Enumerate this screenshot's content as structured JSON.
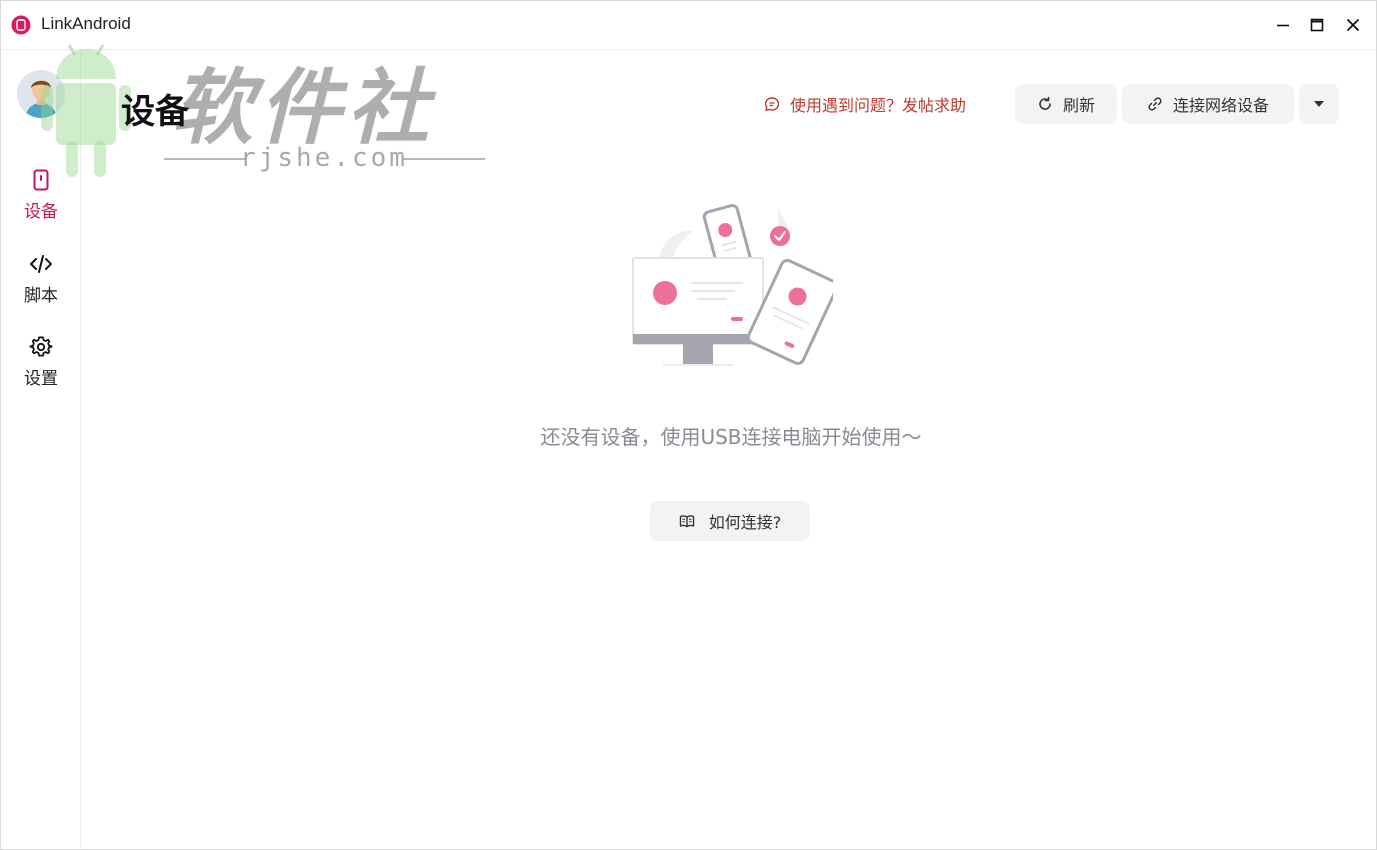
{
  "window": {
    "title": "LinkAndroid"
  },
  "sidebar": {
    "items": [
      {
        "id": "devices",
        "label": "设备",
        "icon": "phone-icon",
        "active": true
      },
      {
        "id": "scripts",
        "label": "脚本",
        "icon": "code-icon",
        "active": false
      },
      {
        "id": "settings",
        "label": "设置",
        "icon": "gear-icon",
        "active": false
      }
    ]
  },
  "watermark": {
    "title": "软件社",
    "subtitle": "rjshe.com"
  },
  "header": {
    "title": "设备",
    "help_link": "使用遇到问题？发帖求助",
    "refresh_label": "刷新",
    "connect_network_label": "连接网络设备"
  },
  "empty_state": {
    "message": "还没有设备，使用USB连接电脑开始使用～",
    "howto_label": "如何连接?"
  },
  "colors": {
    "accent": "#c2185b",
    "link": "#c0392b",
    "button_bg": "#f2f3f5",
    "muted_text": "#8a8a94",
    "illustration_pink": "#ee6f9a"
  }
}
